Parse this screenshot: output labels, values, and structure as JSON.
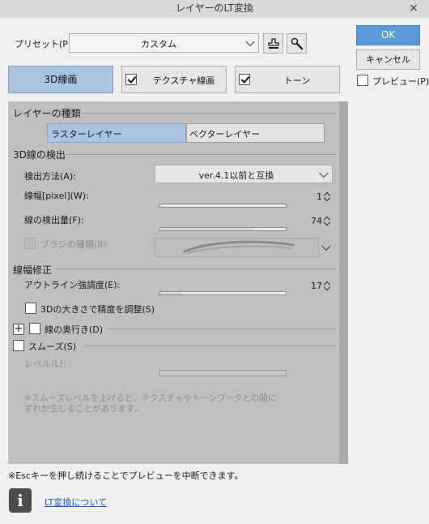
{
  "window": {
    "title": "レイヤーのLT変換",
    "close": "×"
  },
  "preset": {
    "label": "プリセット(P):",
    "value": "カスタム"
  },
  "buttons": {
    "ok": "OK",
    "cancel": "キャンセル",
    "preview_label": "プレビュー(P)"
  },
  "tabs": [
    {
      "label": "3D線画",
      "active": true
    },
    {
      "label": "テクスチャ線画",
      "checked": true
    },
    {
      "label": "トーン",
      "checked": true
    }
  ],
  "layer_type": {
    "heading": "レイヤーの種類",
    "options": [
      "ラスターレイヤー",
      "ベクターレイヤー"
    ],
    "selected": "ラスターレイヤー"
  },
  "line_detect": {
    "heading": "3D線の検出",
    "method_label": "検出方法(A):",
    "method_value": "ver.4.1以前と互換",
    "width_label": "線幅[pixel](W):",
    "width_value": "1",
    "width_fraction": 0.0,
    "amount_label": "線の検出量(F):",
    "amount_value": "74",
    "amount_fraction": 0.74,
    "brush_label": "ブラシの種類(B)"
  },
  "width_correction": {
    "heading": "線幅修正",
    "outline_label": "アウトライン強調度(E):",
    "outline_value": "17",
    "outline_fraction": 0.17,
    "adjust_label": "3Dの大きさで精度を調整(S)"
  },
  "depth": {
    "label": "線の奥行き(D)",
    "expander": "+"
  },
  "smooth": {
    "label": "スムーズ(S)",
    "level_label": "レベル(L):",
    "note_line1": "※スムーズレベルを上げると、テクスチャやトーンワークとの間に",
    "note_line2": "ずれが生じることがあります。"
  },
  "footer": {
    "esc_note": "※Escキーを押し続けることでプレビューを中断できます。",
    "info_icon": "i",
    "about_link": "LT変換について"
  },
  "colors": {
    "ok_button": "#5b9bd5",
    "active_tab": "#a9c4e0",
    "link": "#1a5bc4",
    "panel_bg": "#bfbfbf"
  }
}
